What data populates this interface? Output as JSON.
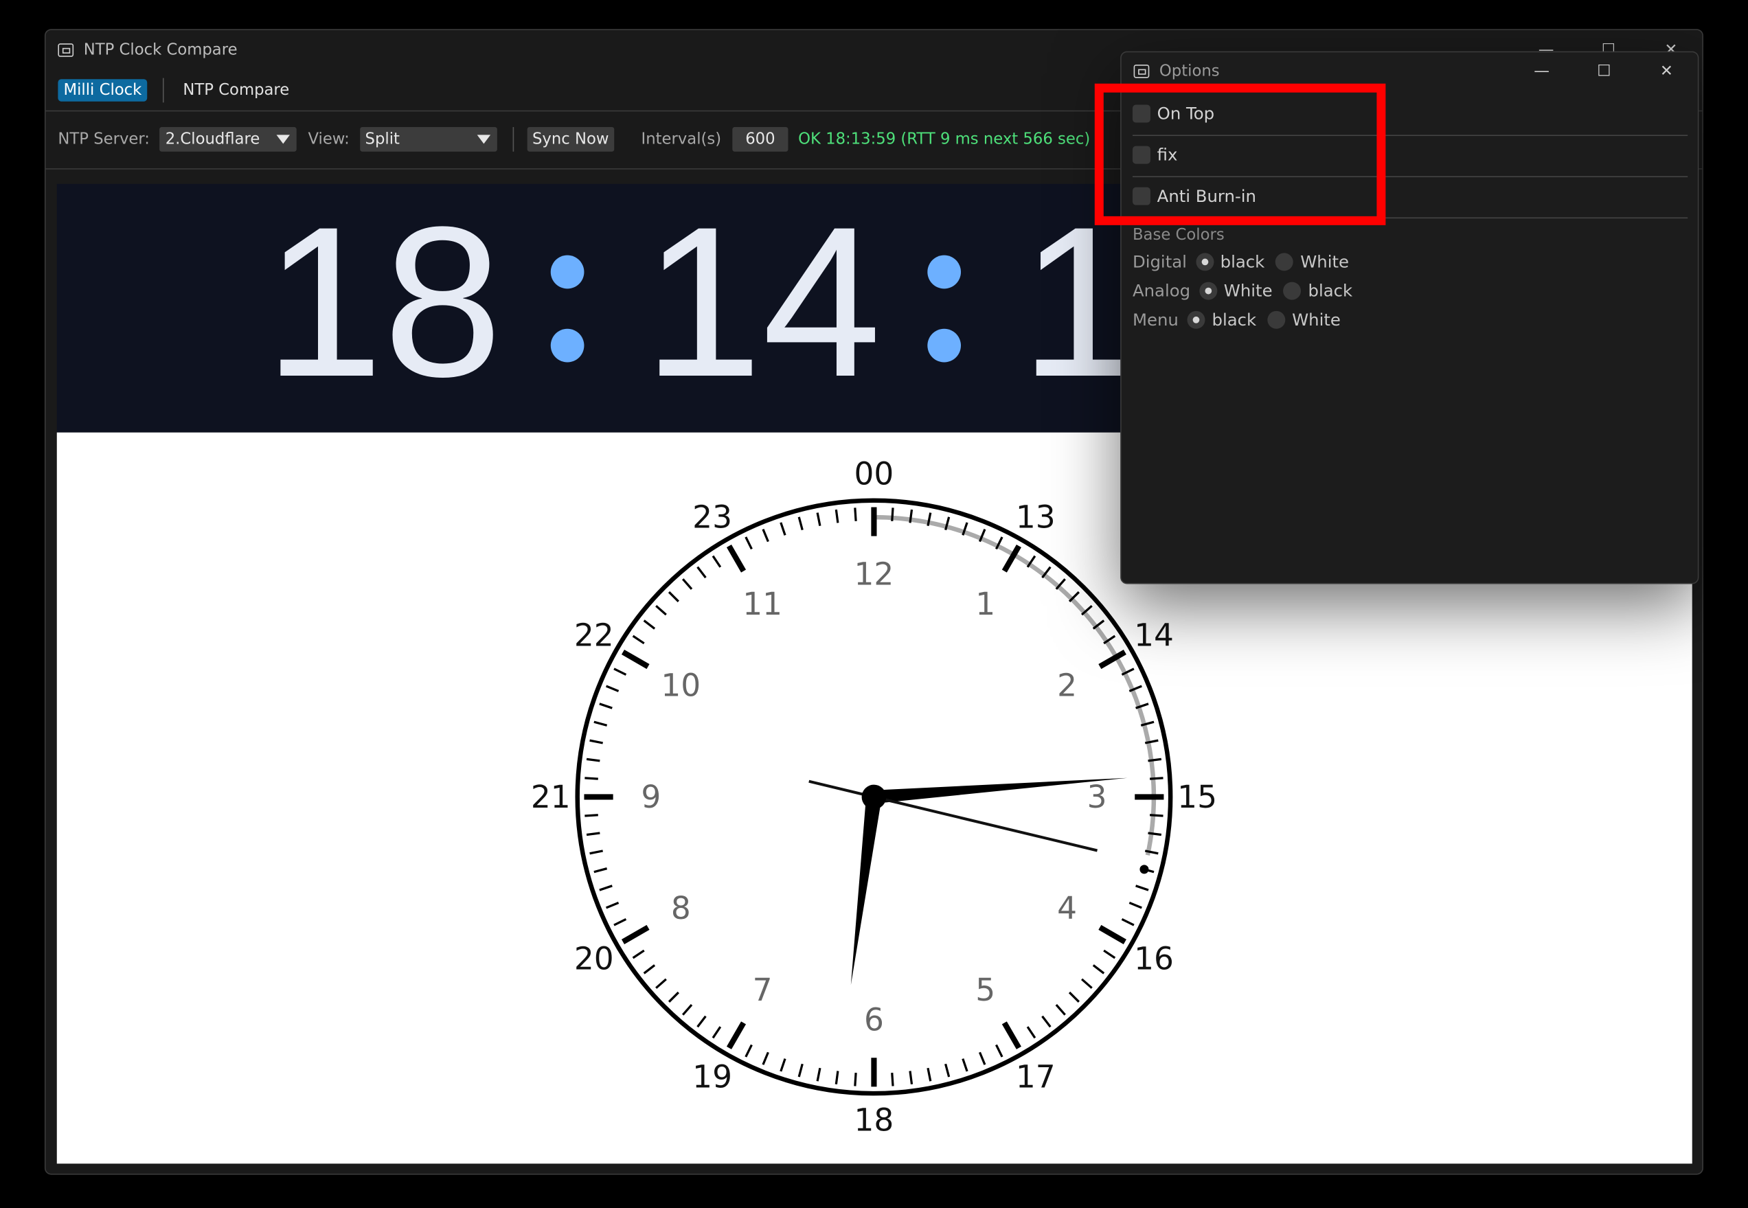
{
  "main_window": {
    "title": "NTP Clock Compare",
    "controls": {
      "minimize": "—",
      "maximize": "☐",
      "close": "✕"
    }
  },
  "tabs": [
    {
      "label": "Milli Clock",
      "active": true
    },
    {
      "label": "NTP Compare",
      "active": false
    }
  ],
  "toolbar": {
    "server_label": "NTP Server:",
    "server_value": "2.Cloudflare",
    "view_label": "View:",
    "view_value": "Split",
    "sync_button": "Sync Now",
    "interval_label": "Interval(s)",
    "interval_value": "600",
    "status": "OK 18:13:59 (RTT 9 ms  next 566 sec)"
  },
  "digital_clock": {
    "hours": "18",
    "minutes": "14",
    "seconds_visible": "1",
    "colon_color": "#6db0ff",
    "digit_color": "#e6ebf5",
    "background": "#0e1220"
  },
  "analog_clock": {
    "outer_labels": [
      "00",
      "13",
      "14",
      "15",
      "16",
      "17",
      "18",
      "19",
      "20",
      "21",
      "22",
      "23"
    ],
    "inner_labels": [
      "12",
      "1",
      "2",
      "3",
      "4",
      "5",
      "6",
      "7",
      "8",
      "9",
      "10",
      "11"
    ],
    "time": {
      "hour": 18,
      "minute": 14,
      "second": 17
    },
    "face_color": "#ffffff",
    "hand_color": "#000000"
  },
  "options_window": {
    "title": "Options",
    "controls": {
      "minimize": "—",
      "maximize": "☐",
      "close": "✕"
    },
    "checkboxes": [
      {
        "label": "On Top",
        "checked": false
      },
      {
        "label": "fix",
        "checked": false
      },
      {
        "label": "Anti Burn-in",
        "checked": false
      }
    ],
    "base_colors_title": "Base Colors",
    "digital": {
      "label": "Digital",
      "opt1": "black",
      "opt2": "White",
      "selected": "black"
    },
    "analog": {
      "label": "Analog",
      "opt1": "White",
      "opt2": "black",
      "selected": "White"
    },
    "menu": {
      "label": "Menu",
      "opt1": "black",
      "opt2": "White",
      "selected": "black"
    }
  },
  "annotation": {
    "color": "#ff0000",
    "target": "checkbox options"
  }
}
